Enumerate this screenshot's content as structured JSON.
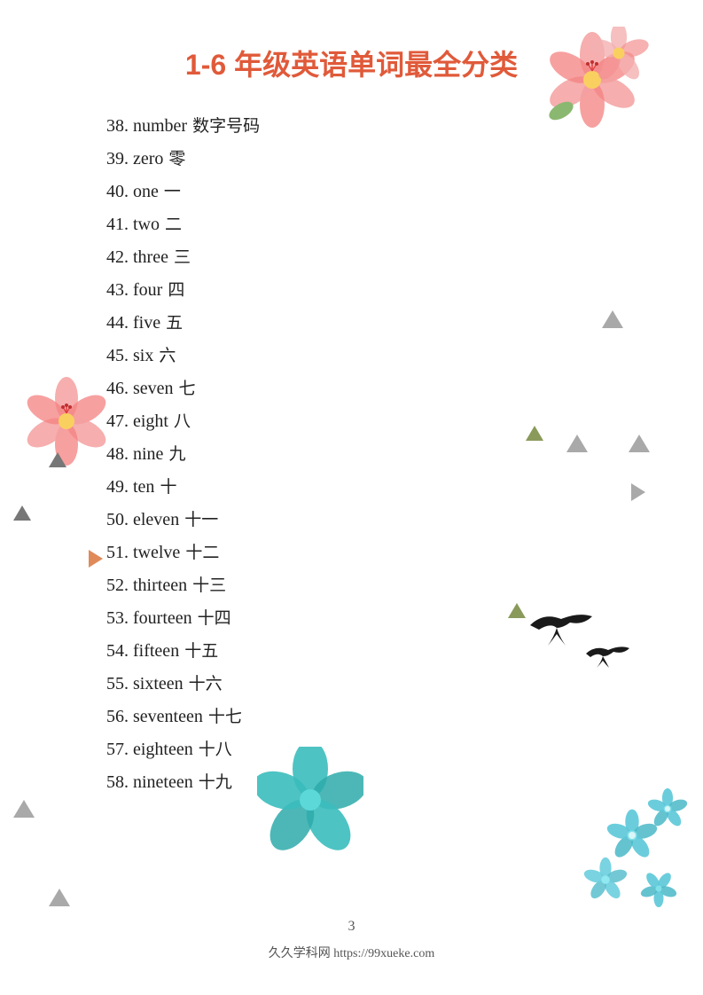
{
  "title": "1-6 年级英语单词最全分类",
  "words": [
    {
      "num": "38.",
      "english": "number",
      "chinese": "数字号码"
    },
    {
      "num": "39.",
      "english": "zero",
      "chinese": "零"
    },
    {
      "num": "40.",
      "english": "one",
      "chinese": "一"
    },
    {
      "num": "41.",
      "english": "two",
      "chinese": "二"
    },
    {
      "num": "42.",
      "english": "three",
      "chinese": "三"
    },
    {
      "num": "43.",
      "english": "four",
      "chinese": "四"
    },
    {
      "num": "44.",
      "english": "five",
      "chinese": "五"
    },
    {
      "num": "45.",
      "english": "six",
      "chinese": "六"
    },
    {
      "num": "46.",
      "english": "seven",
      "chinese": "七"
    },
    {
      "num": "47.",
      "english": "eight",
      "chinese": "八"
    },
    {
      "num": "48.",
      "english": "nine",
      "chinese": "九"
    },
    {
      "num": "49.",
      "english": "ten",
      "chinese": "十"
    },
    {
      "num": "50.",
      "english": "eleven",
      "chinese": "十一"
    },
    {
      "num": "51.",
      "english": "twelve",
      "chinese": "十二"
    },
    {
      "num": "52.",
      "english": "thirteen",
      "chinese": "十三"
    },
    {
      "num": "53.",
      "english": "fourteen",
      "chinese": "十四"
    },
    {
      "num": "54.",
      "english": "fifteen",
      "chinese": "十五"
    },
    {
      "num": "55.",
      "english": "sixteen",
      "chinese": "十六"
    },
    {
      "num": "56.",
      "english": "seventeen",
      "chinese": "十七"
    },
    {
      "num": "57.",
      "english": "eighteen",
      "chinese": "十八"
    },
    {
      "num": "58.",
      "english": "nineteen",
      "chinese": "十九"
    }
  ],
  "page_number": "3",
  "footer": "久久学科网 https://99xueke.com"
}
